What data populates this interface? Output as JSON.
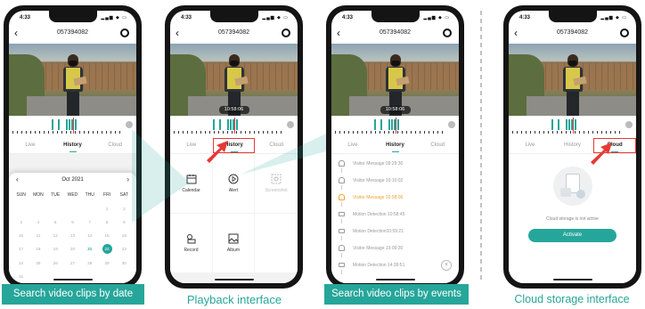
{
  "device": {
    "time": "4:33",
    "camera_id": "057394082",
    "video_timestamp": "10:58:06"
  },
  "tabs": [
    "Live",
    "History",
    "Cloud"
  ],
  "playback_menu": [
    {
      "label": "Calendar",
      "icon": "calendar-icon"
    },
    {
      "label": "Alert",
      "icon": "play-circle-icon"
    },
    {
      "label": "Screenshot",
      "icon": "screenshot-icon"
    },
    {
      "label": "Record",
      "icon": "record-icon"
    },
    {
      "label": "Album",
      "icon": "album-icon"
    }
  ],
  "calendar": {
    "month": "Oct 2021",
    "weekdays": [
      "SUN",
      "MON",
      "TUE",
      "WED",
      "THU",
      "FRI",
      "SAT"
    ],
    "leading_blanks": 5,
    "days": [
      "1",
      "2",
      "3",
      "4",
      "5",
      "6",
      "7",
      "8",
      "9",
      "10",
      "11",
      "12",
      "13",
      "14",
      "15",
      "16",
      "17",
      "18",
      "19",
      "20",
      "21",
      "22",
      "23",
      "24",
      "25",
      "26",
      "27",
      "28",
      "29",
      "30",
      "31"
    ],
    "recorded_days": [
      "21"
    ],
    "selected_day": "22"
  },
  "events": [
    {
      "label": "Visitor Message 09:29:30",
      "type": "bell",
      "highlight": false
    },
    {
      "label": "Visitor Message 10:10:02",
      "type": "bell",
      "highlight": false
    },
    {
      "label": "Visitor Message 10:58:06",
      "type": "bell",
      "highlight": true
    },
    {
      "label": "Motion Detection 10:58:45",
      "type": "motion",
      "highlight": false
    },
    {
      "label": "Motion Detection10:59:21",
      "type": "motion",
      "highlight": false
    },
    {
      "label": "Visitor Message 13:09:30",
      "type": "bell",
      "highlight": false
    },
    {
      "label": "Motion Detection 14:39:51",
      "type": "motion",
      "highlight": false
    }
  ],
  "cloud": {
    "status_message": "Cloud storage is not active",
    "activate_label": "Activate"
  },
  "captions": {
    "date": "Search video clips by date",
    "playback": "Playback interface",
    "events": "Search video clips by events",
    "cloud": "Cloud storage interface"
  },
  "colors": {
    "accent": "#26a69a",
    "highlight_box": "#e53935",
    "event_highlight": "#f0a030"
  }
}
